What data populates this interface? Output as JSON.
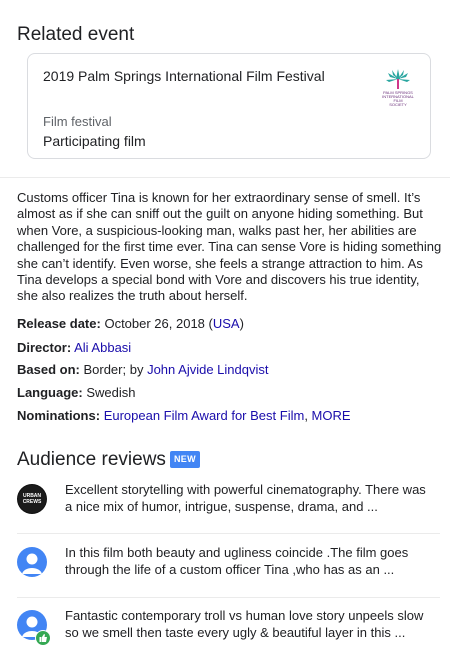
{
  "related_event": {
    "heading": "Related event",
    "title": "2019 Palm Springs International Film Festival",
    "type": "Film festival",
    "role": "Participating film",
    "logo_text": [
      "PALM SPRINGS",
      "INTERNATIONAL",
      "FILM",
      "SOCIETY"
    ]
  },
  "description": "Customs officer Tina is known for her extraordinary sense of smell. It’s almost as if she can sniff out the guilt on anyone hiding something. But when Vore, a suspicious-looking man, walks past her, her abilities are challenged for the first time ever. Tina can sense Vore is hiding something she can’t identify. Even worse, she feels a strange attraction to him. As Tina develops a special bond with Vore and discovers his true identity, she also realizes the truth about herself.",
  "facts": {
    "release_label": "Release date:",
    "release_value": "October 26, 2018",
    "release_region": "USA",
    "director_label": "Director:",
    "director_value": "Ali Abbasi",
    "based_label": "Based on:",
    "based_prefix": "Border; by",
    "based_value": "John Ajvide Lindqvist",
    "language_label": "Language:",
    "language_value": "Swedish",
    "nominations_label": "Nominations:",
    "nominations_value": "European Film Award for Best Film",
    "nominations_more": "MORE"
  },
  "reviews": {
    "heading": "Audience reviews",
    "badge": "NEW",
    "items": [
      {
        "text": "Excellent storytelling with powerful cinematography. There was a nice mix of humor, intrigue, suspense, drama, and ...",
        "avatar_text": [
          "URBAN",
          "CREWS"
        ]
      },
      {
        "text": "In this film both beauty and ugliness coincide .The film goes through the life of a custom officer Tina ,who has as an ..."
      },
      {
        "text": "Fantastic contemporary troll vs human love story unpeels slow so we smell then taste every ugly & beautiful layer in this ..."
      }
    ]
  },
  "colors": {
    "link": "#1a0dab",
    "badge": "#4285f4",
    "avatar": "#4285f4",
    "thumb": "#34a853"
  }
}
